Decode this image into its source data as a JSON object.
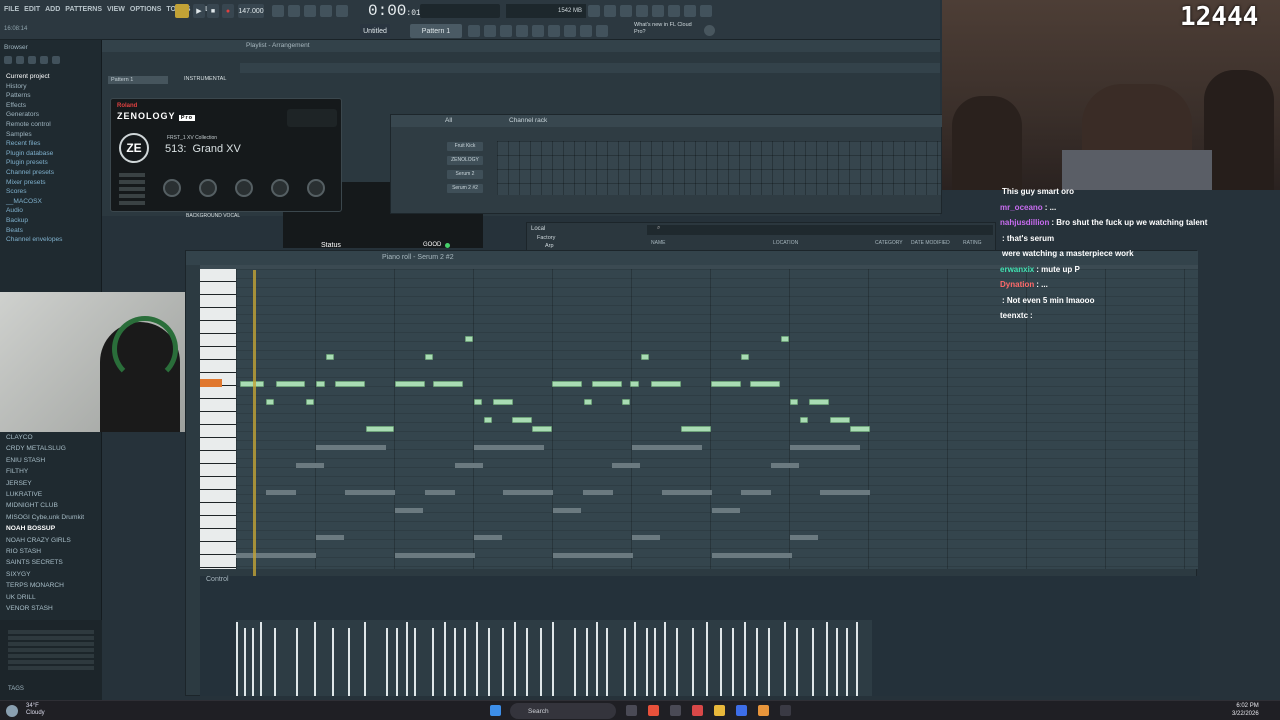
{
  "menu": [
    "FILE",
    "EDIT",
    "ADD",
    "PATTERNS",
    "VIEW",
    "OPTIONS",
    "TOOLS",
    "HELP"
  ],
  "toolbar": {
    "tempo": "147.000",
    "time": "0:00",
    "time_small": ":01",
    "pattern": "Pattern 1",
    "news": "What's new in FL Cloud Pro?",
    "project": "Untitled",
    "cpu": "1542 MB"
  },
  "browser": {
    "tree": [
      {
        "label": "Current project",
        "cls": "sel"
      },
      {
        "label": "History",
        "cls": ""
      },
      {
        "label": "Patterns",
        "cls": ""
      },
      {
        "label": "Effects",
        "cls": ""
      },
      {
        "label": "Generators",
        "cls": ""
      },
      {
        "label": "Remote control",
        "cls": ""
      },
      {
        "label": "Samples",
        "cls": ""
      },
      {
        "label": "Recent files",
        "cls": "folder"
      },
      {
        "label": "Plugin database",
        "cls": "folder"
      },
      {
        "label": "Plugin presets",
        "cls": "folder"
      },
      {
        "label": "Channel presets",
        "cls": "folder"
      },
      {
        "label": "Mixer presets",
        "cls": "folder"
      },
      {
        "label": "Scores",
        "cls": "folder"
      },
      {
        "label": "__MACOSX",
        "cls": "folder"
      },
      {
        "label": "Audio",
        "cls": "folder"
      },
      {
        "label": "Backup",
        "cls": "folder"
      },
      {
        "label": "Beats",
        "cls": "folder"
      },
      {
        "label": "Channel envelopes",
        "cls": "folder"
      }
    ],
    "folders": [
      {
        "label": "CLAYCO",
        "cls": ""
      },
      {
        "label": "CRDY METALSLUG",
        "cls": ""
      },
      {
        "label": "ENIU STASH",
        "cls": ""
      },
      {
        "label": "FILTHY",
        "cls": ""
      },
      {
        "label": "JERSEY",
        "cls": ""
      },
      {
        "label": "LUKRATIVE",
        "cls": ""
      },
      {
        "label": "MIDNIGHT CLUB",
        "cls": ""
      },
      {
        "label": "MISOGI Cybe,unk Drumkit",
        "cls": ""
      },
      {
        "label": "NOAH BOSSUP",
        "cls": "hl"
      },
      {
        "label": "NOAH CRAZY GIRLS",
        "cls": ""
      },
      {
        "label": "RIO STASH",
        "cls": ""
      },
      {
        "label": "SAINTS SECRETS",
        "cls": ""
      },
      {
        "label": "SIXYGY",
        "cls": ""
      },
      {
        "label": "TERPS MONARCH",
        "cls": ""
      },
      {
        "label": "UK DRILL",
        "cls": ""
      },
      {
        "label": "VENOR STASH",
        "cls": ""
      }
    ],
    "tags": "TAGS"
  },
  "playlist": {
    "title": "Playlist - Arrangement",
    "track": "Pattern 1",
    "instrumental": "INSTRUMENTAL",
    "bg_vocal": "BACKGROUND VOCAL",
    "status_label": "Status",
    "status_value": "GOOD"
  },
  "zenology": {
    "brand": "Roland",
    "title": "ZENOLOGY",
    "edition": "Pro",
    "collection": "FRST_1 XV Collection",
    "patch_num": "513:",
    "patch_name": "Grand XV",
    "knobs": [
      "OUTPUT",
      "REVERB",
      "ATTACK",
      "RELEASE",
      "VIBRATO"
    ]
  },
  "channel_rack": {
    "title": "Channel rack",
    "filter": "All",
    "channels": [
      "Fruit Kick",
      "ZENOLOGY",
      "Serum 2",
      "Serum 2 #2"
    ]
  },
  "browser_panel": {
    "location": "Local",
    "items": [
      "Factory",
      "Arp"
    ],
    "columns": [
      "NAME",
      "LOCATION",
      "CATEGORY",
      "DATE MODIFIED",
      "RATING"
    ]
  },
  "piano_roll": {
    "title": "Piano roll - Serum 2 #2",
    "control": "Control",
    "key_labels": [
      "C7",
      "C6",
      "C5"
    ]
  },
  "stream": {
    "viewers": "12444"
  },
  "chat": [
    {
      "user": "",
      "msg": "This guy smart oro",
      "color": "#ffffff"
    },
    {
      "user": "mr_oceano",
      "msg": ": ...",
      "color": "#c86cf0"
    },
    {
      "user": "nahjusdillion",
      "msg": ": Bro shut the fuck up we watching talent",
      "color": "#c86cf0"
    },
    {
      "user": "",
      "msg": ": that's serum",
      "color": "#e05050"
    },
    {
      "user": "",
      "msg": "were watching a masterpiece work",
      "color": "#4f8bff"
    },
    {
      "user": "erwanxix",
      "msg": ": mute up P",
      "color": "#40e0b0"
    },
    {
      "user": "Dynation",
      "msg": ": ...",
      "color": "#ff6a6a"
    },
    {
      "user": "",
      "msg": ": Not even 5 min lmaooo",
      "color": "#4f8bff"
    },
    {
      "user": "teenxtc",
      "msg": ":",
      "color": "#ffffff"
    }
  ],
  "taskbar": {
    "temp": "34°F",
    "weather": "Cloudy",
    "search": "Search",
    "time": "6:02 PM",
    "date": "3/22/2026"
  },
  "colors": {
    "accent": "#a9dcb4",
    "playhead": "#c2a236",
    "bg": "#26323a"
  }
}
